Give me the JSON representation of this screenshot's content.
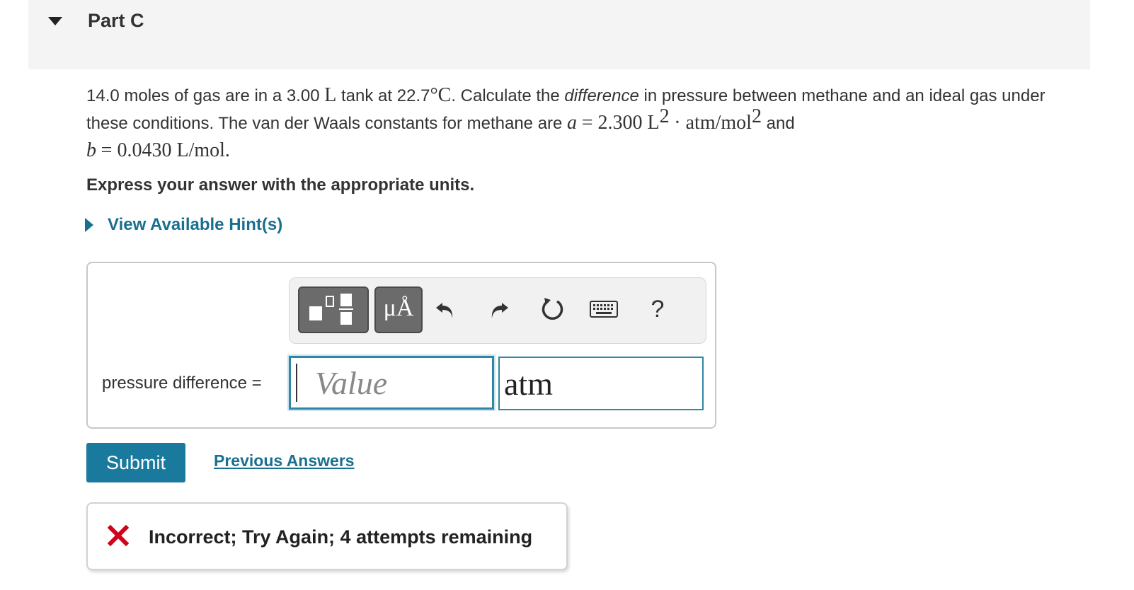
{
  "part": {
    "title": "Part C"
  },
  "problem": {
    "t1": "14.0 moles of gas are in a 3.00",
    "unit_L": "L",
    "t2": "tank at 22.7",
    "deg": "°",
    "unit_C": "C",
    "t3": ". Calculate the",
    "emph": "difference",
    "t4": "in pressure between methane and an ideal gas under these conditions. The van der Waals constants for methane are",
    "a_sym": "a",
    "a_val": "= 2.300 L",
    "sq1": "2",
    "a_unit": "· atm/mol",
    "sq2": "2",
    "t5": "and",
    "b_sym": "b",
    "b_val": "= 0.0430 L/mol."
  },
  "instruction": "Express your answer with the appropriate units.",
  "hint": {
    "label": "View Available Hint(s)"
  },
  "toolbar": {
    "units_glyph": "μÅ",
    "help": "?"
  },
  "answer": {
    "label": "pressure difference =",
    "value_placeholder": "Value",
    "value": "",
    "units_value": "atm"
  },
  "actions": {
    "submit_label": "Submit",
    "previous_label": "Previous Answers"
  },
  "feedback": {
    "text": "Incorrect; Try Again; 4 attempts remaining"
  },
  "colors": {
    "accent": "#1a7a9d",
    "link": "#1a6f8f",
    "error": "#d0021b"
  }
}
